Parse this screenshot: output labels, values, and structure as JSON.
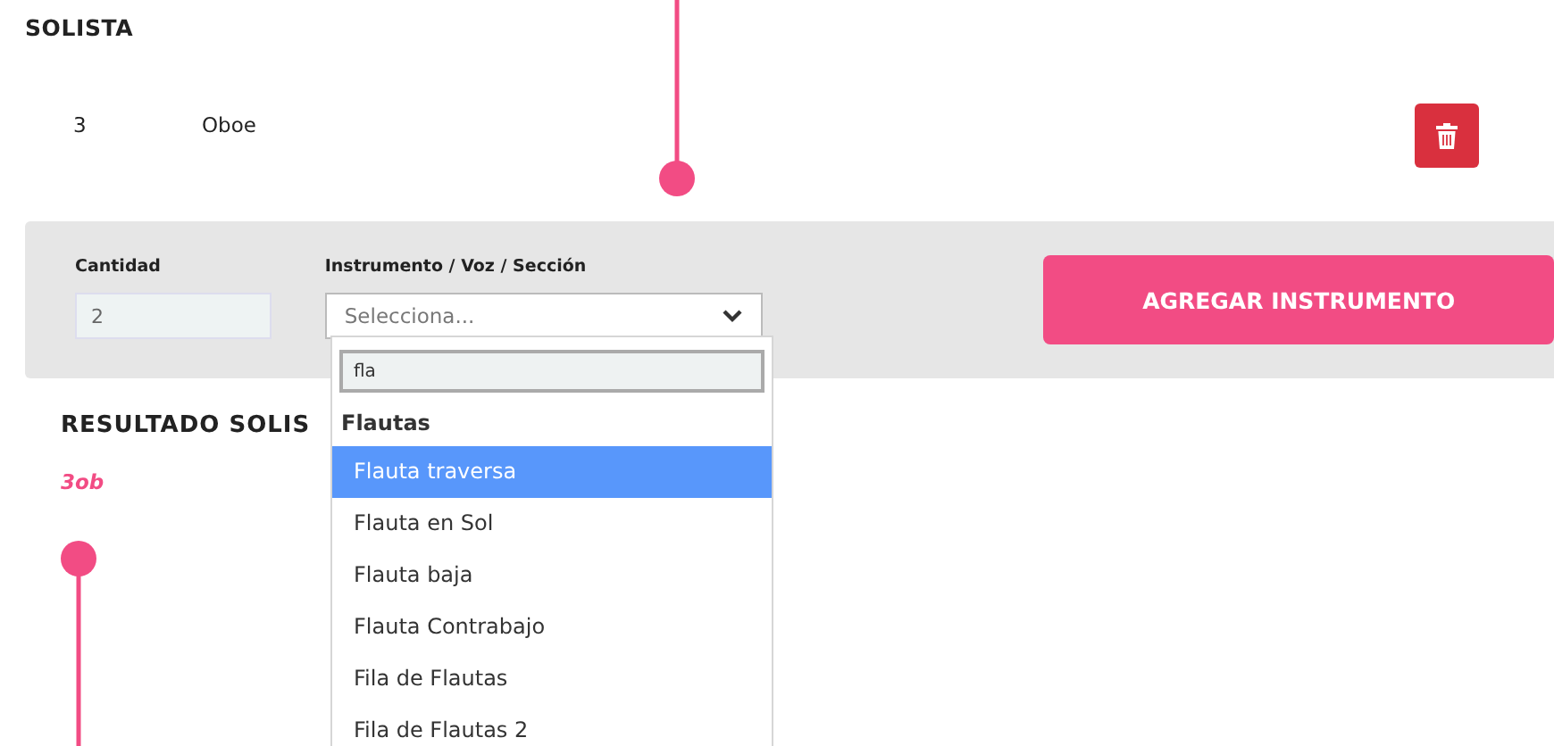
{
  "section": {
    "title": "SOLISTA"
  },
  "rows": [
    {
      "quantity": "3",
      "instrument": "Oboe"
    }
  ],
  "form": {
    "quantity_label": "Cantidad",
    "quantity_value": "2",
    "instrument_label": "Instrumento / Voz / Sección",
    "instrument_placeholder": "Selecciona...",
    "expanded": true,
    "search_value": "fla",
    "group": "Flautas",
    "options": [
      {
        "label": "Flauta traversa",
        "selected": true
      },
      {
        "label": "Flauta en Sol",
        "selected": false
      },
      {
        "label": "Flauta baja",
        "selected": false
      },
      {
        "label": "Flauta Contrabajo",
        "selected": false
      },
      {
        "label": "Fila de Flautas",
        "selected": false
      },
      {
        "label": "Fila de Flautas 2",
        "selected": false
      }
    ],
    "add_button": "AGREGAR INSTRUMENTO"
  },
  "result": {
    "title": "RESULTADO SOLIS",
    "value": "3ob"
  }
}
